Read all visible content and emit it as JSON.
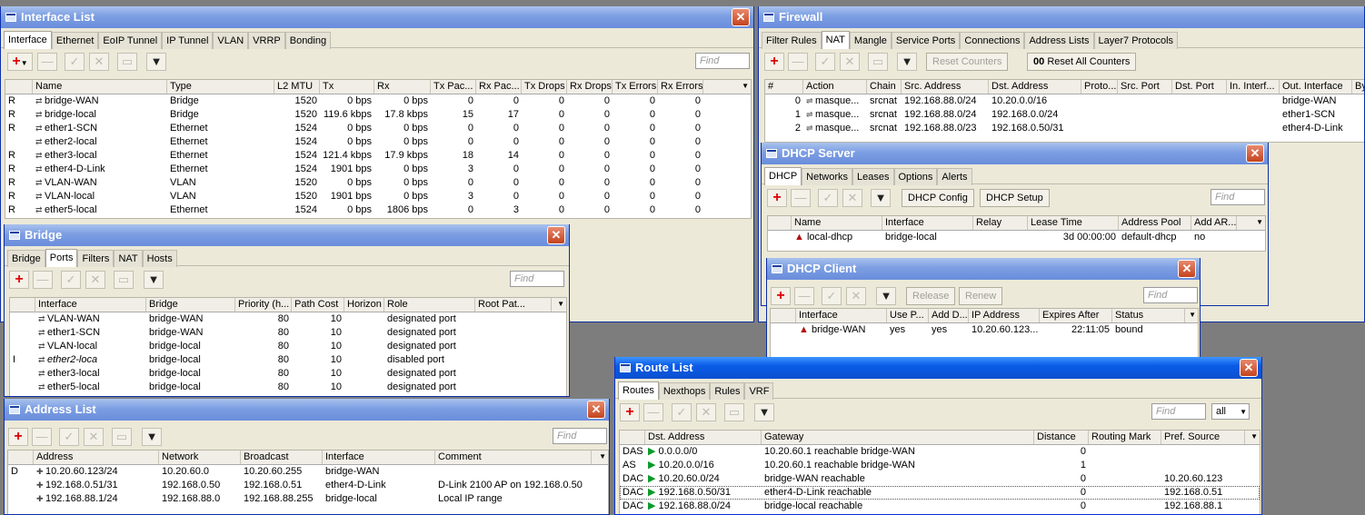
{
  "interface_list": {
    "title": "Interface List",
    "tabs": [
      "Interface",
      "Ethernet",
      "EoIP Tunnel",
      "IP Tunnel",
      "VLAN",
      "VRRP",
      "Bonding"
    ],
    "find_placeholder": "Find",
    "columns": [
      "Name",
      "Type",
      "L2 MTU",
      "Tx",
      "Rx",
      "Tx Pac...",
      "Rx Pac...",
      "Tx Drops",
      "Rx Drops",
      "Tx Errors",
      "Rx Errors"
    ],
    "rows": [
      {
        "flag": "R",
        "name": "bridge-WAN",
        "type": "Bridge",
        "mtu": "1520",
        "tx": "0 bps",
        "rx": "0 bps",
        "txp": "0",
        "rxp": "0",
        "txd": "0",
        "rxd": "0",
        "txe": "0",
        "rxe": "0"
      },
      {
        "flag": "R",
        "name": "bridge-local",
        "type": "Bridge",
        "mtu": "1520",
        "tx": "119.6 kbps",
        "rx": "17.8 kbps",
        "txp": "15",
        "rxp": "17",
        "txd": "0",
        "rxd": "0",
        "txe": "0",
        "rxe": "0"
      },
      {
        "flag": "R",
        "name": "ether1-SCN",
        "type": "Ethernet",
        "mtu": "1524",
        "tx": "0 bps",
        "rx": "0 bps",
        "txp": "0",
        "rxp": "0",
        "txd": "0",
        "rxd": "0",
        "txe": "0",
        "rxe": "0"
      },
      {
        "flag": "",
        "name": "ether2-local",
        "type": "Ethernet",
        "mtu": "1524",
        "tx": "0 bps",
        "rx": "0 bps",
        "txp": "0",
        "rxp": "0",
        "txd": "0",
        "rxd": "0",
        "txe": "0",
        "rxe": "0"
      },
      {
        "flag": "R",
        "name": "ether3-local",
        "type": "Ethernet",
        "mtu": "1524",
        "tx": "121.4 kbps",
        "rx": "17.9 kbps",
        "txp": "18",
        "rxp": "14",
        "txd": "0",
        "rxd": "0",
        "txe": "0",
        "rxe": "0"
      },
      {
        "flag": "R",
        "name": "ether4-D-Link",
        "type": "Ethernet",
        "mtu": "1524",
        "tx": "1901 bps",
        "rx": "0 bps",
        "txp": "3",
        "rxp": "0",
        "txd": "0",
        "rxd": "0",
        "txe": "0",
        "rxe": "0"
      },
      {
        "flag": "R",
        "name": "VLAN-WAN",
        "type": "VLAN",
        "mtu": "1520",
        "tx": "0 bps",
        "rx": "0 bps",
        "txp": "0",
        "rxp": "0",
        "txd": "0",
        "rxd": "0",
        "txe": "0",
        "rxe": "0"
      },
      {
        "flag": "R",
        "name": "VLAN-local",
        "type": "VLAN",
        "mtu": "1520",
        "tx": "1901 bps",
        "rx": "0 bps",
        "txp": "3",
        "rxp": "0",
        "txd": "0",
        "rxd": "0",
        "txe": "0",
        "rxe": "0"
      },
      {
        "flag": "R",
        "name": "ether5-local",
        "type": "Ethernet",
        "mtu": "1524",
        "tx": "0 bps",
        "rx": "1806 bps",
        "txp": "0",
        "rxp": "3",
        "txd": "0",
        "rxd": "0",
        "txe": "0",
        "rxe": "0"
      }
    ]
  },
  "firewall": {
    "title": "Firewall",
    "tabs": [
      "Filter Rules",
      "NAT",
      "Mangle",
      "Service Ports",
      "Connections",
      "Address Lists",
      "Layer7 Protocols"
    ],
    "reset_counters": "Reset Counters",
    "reset_all_counters": "Reset All Counters",
    "reset_all_prefix": "00",
    "columns": [
      "#",
      "Action",
      "Chain",
      "Src. Address",
      "Dst. Address",
      "Proto...",
      "Src. Port",
      "Dst. Port",
      "In. Interf...",
      "Out. Interface",
      "By"
    ],
    "rows": [
      {
        "n": "0",
        "action": "masque...",
        "chain": "srcnat",
        "src": "192.168.88.0/24",
        "dst": "10.20.0.0/16",
        "out": "bridge-WAN"
      },
      {
        "n": "1",
        "action": "masque...",
        "chain": "srcnat",
        "src": "192.168.88.0/24",
        "dst": "192.168.0.0/24",
        "out": "ether1-SCN"
      },
      {
        "n": "2",
        "action": "masque...",
        "chain": "srcnat",
        "src": "192.168.88.0/23",
        "dst": "192.168.0.50/31",
        "out": "ether4-D-Link"
      }
    ]
  },
  "bridge": {
    "title": "Bridge",
    "tabs": [
      "Bridge",
      "Ports",
      "Filters",
      "NAT",
      "Hosts"
    ],
    "find_placeholder": "Find",
    "columns": [
      "Interface",
      "Bridge",
      "Priority (h...",
      "Path Cost",
      "Horizon",
      "Role",
      "Root Pat..."
    ],
    "rows": [
      {
        "flag": "",
        "iface": "VLAN-WAN",
        "bridge": "bridge-WAN",
        "prio": "80",
        "cost": "10",
        "role": "designated port"
      },
      {
        "flag": "",
        "iface": "ether1-SCN",
        "bridge": "bridge-WAN",
        "prio": "80",
        "cost": "10",
        "role": "designated port"
      },
      {
        "flag": "",
        "iface": "VLAN-local",
        "bridge": "bridge-local",
        "prio": "80",
        "cost": "10",
        "role": "designated port"
      },
      {
        "flag": "I",
        "iface": "ether2-loca",
        "bridge": "bridge-local",
        "prio": "80",
        "cost": "10",
        "role": "disabled port"
      },
      {
        "flag": "",
        "iface": "ether3-local",
        "bridge": "bridge-local",
        "prio": "80",
        "cost": "10",
        "role": "designated port"
      },
      {
        "flag": "",
        "iface": "ether5-local",
        "bridge": "bridge-local",
        "prio": "80",
        "cost": "10",
        "role": "designated port"
      }
    ]
  },
  "dhcp_server": {
    "title": "DHCP Server",
    "tabs": [
      "DHCP",
      "Networks",
      "Leases",
      "Options",
      "Alerts"
    ],
    "config_btn": "DHCP Config",
    "setup_btn": "DHCP Setup",
    "find_placeholder": "Find",
    "columns": [
      "Name",
      "Interface",
      "Relay",
      "Lease Time",
      "Address Pool",
      "Add AR..."
    ],
    "rows": [
      {
        "name": "local-dhcp",
        "iface": "bridge-local",
        "relay": "",
        "lease": "3d 00:00:00",
        "pool": "default-dhcp",
        "addar": "no"
      }
    ]
  },
  "dhcp_client": {
    "title": "DHCP Client",
    "release_btn": "Release",
    "renew_btn": "Renew",
    "find_placeholder": "Find",
    "columns": [
      "Interface",
      "Use P...",
      "Add D...",
      "IP Address",
      "Expires After",
      "Status"
    ],
    "rows": [
      {
        "iface": "bridge-WAN",
        "usep": "yes",
        "addd": "yes",
        "ip": "10.20.60.123...",
        "expires": "22:11:05",
        "status": "bound"
      }
    ]
  },
  "address_list": {
    "title": "Address List",
    "find_placeholder": "Find",
    "columns": [
      "Address",
      "Network",
      "Broadcast",
      "Interface",
      "Comment"
    ],
    "rows": [
      {
        "flag": "D",
        "addr": "10.20.60.123/24",
        "net": "10.20.60.0",
        "bcast": "10.20.60.255",
        "iface": "bridge-WAN",
        "comment": ""
      },
      {
        "flag": "",
        "addr": "192.168.0.51/31",
        "net": "192.168.0.50",
        "bcast": "192.168.0.51",
        "iface": "ether4-D-Link",
        "comment": "D-Link 2100 AP on 192.168.0.50"
      },
      {
        "flag": "",
        "addr": "192.168.88.1/24",
        "net": "192.168.88.0",
        "bcast": "192.168.88.255",
        "iface": "bridge-local",
        "comment": "Local IP range"
      }
    ]
  },
  "route_list": {
    "title": "Route List",
    "tabs": [
      "Routes",
      "Nexthops",
      "Rules",
      "VRF"
    ],
    "find_placeholder": "Find",
    "filter_value": "all",
    "columns": [
      "Dst. Address",
      "Gateway",
      "Distance",
      "Routing Mark",
      "Pref. Source"
    ],
    "rows": [
      {
        "flag": "DAS",
        "dst": "0.0.0.0/0",
        "gw": "10.20.60.1 reachable bridge-WAN",
        "dist": "0",
        "mark": "",
        "pref": ""
      },
      {
        "flag": "AS",
        "dst": "10.20.0.0/16",
        "gw": "10.20.60.1 reachable bridge-WAN",
        "dist": "1",
        "mark": "",
        "pref": ""
      },
      {
        "flag": "DAC",
        "dst": "10.20.60.0/24",
        "gw": "bridge-WAN reachable",
        "dist": "0",
        "mark": "",
        "pref": "10.20.60.123"
      },
      {
        "flag": "DAC",
        "dst": "192.168.0.50/31",
        "gw": "ether4-D-Link reachable",
        "dist": "0",
        "mark": "",
        "pref": "192.168.0.51"
      },
      {
        "flag": "DAC",
        "dst": "192.168.88.0/24",
        "gw": "bridge-local reachable",
        "dist": "0",
        "mark": "",
        "pref": "192.168.88.1"
      }
    ]
  }
}
